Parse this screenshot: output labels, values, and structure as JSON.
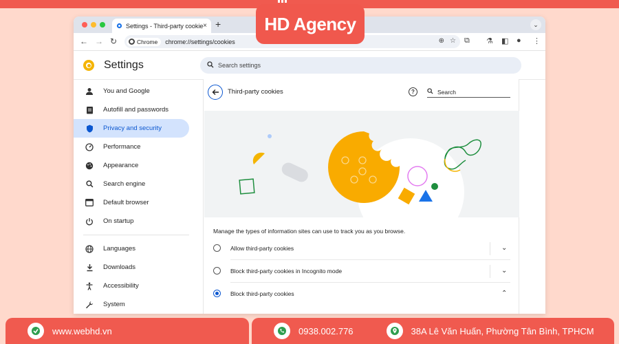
{
  "brand": {
    "logo_text": "HD Agency"
  },
  "browser": {
    "tab_title": "Settings - Third-party cookie",
    "tab_close": "×",
    "new_tab": "+",
    "chip_label": "Chrome",
    "url": "chrome://settings/cookies"
  },
  "settings": {
    "title": "Settings",
    "search_placeholder": "Search settings"
  },
  "sidebar": {
    "items": [
      {
        "label": "You and Google",
        "icon": "person-icon"
      },
      {
        "label": "Autofill and passwords",
        "icon": "clipboard-icon"
      },
      {
        "label": "Privacy and security",
        "icon": "shield-icon",
        "active": true
      },
      {
        "label": "Performance",
        "icon": "speedometer-icon"
      },
      {
        "label": "Appearance",
        "icon": "palette-icon"
      },
      {
        "label": "Search engine",
        "icon": "search-icon"
      },
      {
        "label": "Default browser",
        "icon": "browser-window-icon"
      },
      {
        "label": "On startup",
        "icon": "power-icon"
      },
      {
        "label": "Languages",
        "icon": "globe-icon"
      },
      {
        "label": "Downloads",
        "icon": "download-icon"
      },
      {
        "label": "Accessibility",
        "icon": "accessibility-icon"
      },
      {
        "label": "System",
        "icon": "wrench-icon"
      }
    ]
  },
  "panel": {
    "title": "Third-party cookies",
    "search_label": "Search",
    "description": "Manage the types of information sites can use to track you as you browse.",
    "options": [
      {
        "label": "Allow third-party cookies",
        "selected": false,
        "expanded": false
      },
      {
        "label": "Block third-party cookies in Incognito mode",
        "selected": false,
        "expanded": false
      },
      {
        "label": "Block third-party cookies",
        "selected": true,
        "expanded": true
      }
    ]
  },
  "footer": {
    "website": "www.webhd.vn",
    "phone": "0938.002.776",
    "address": "38A Lê Văn Huấn, Phường Tân Bình, TPHCM"
  },
  "colors": {
    "accent": "#0b57d0",
    "active_bg": "#d3e3fd",
    "brand_red": "#f05a4f",
    "cookie_yellow": "#f4b400"
  }
}
